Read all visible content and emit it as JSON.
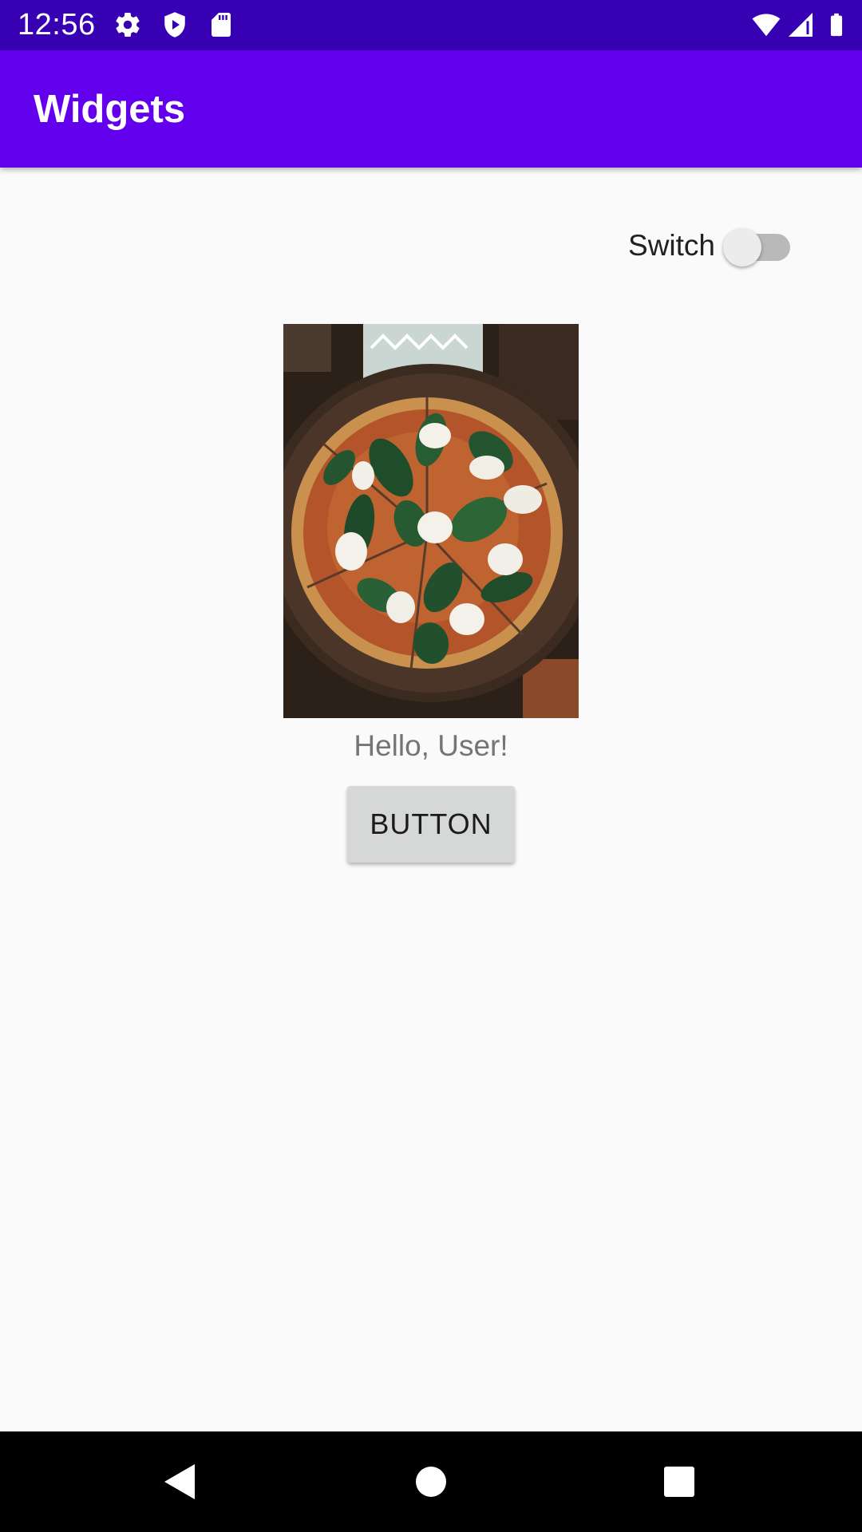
{
  "status_bar": {
    "time": "12:56",
    "background": "#3700b3",
    "icons": [
      "settings-icon",
      "shield-play-icon",
      "sd-card-icon",
      "wifi-icon",
      "signal-icon",
      "battery-icon"
    ]
  },
  "app_bar": {
    "title": "Widgets",
    "background": "#6200ee"
  },
  "switch": {
    "label": "Switch",
    "checked": false
  },
  "image": {
    "subject": "pizza-photo"
  },
  "greeting": {
    "text": "Hello, User!"
  },
  "button": {
    "label": "BUTTON"
  },
  "nav_bar": {
    "icons": [
      "back-icon",
      "home-icon",
      "recents-icon"
    ]
  }
}
